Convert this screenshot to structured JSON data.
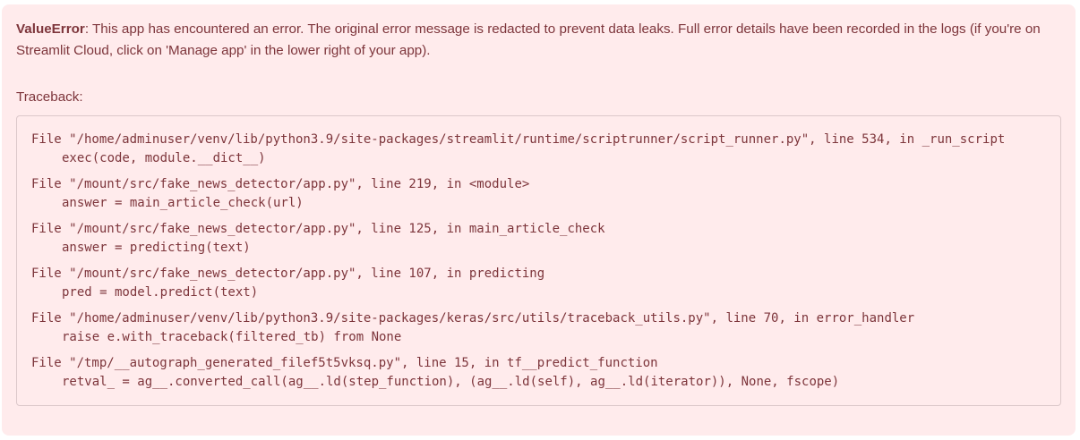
{
  "error": {
    "type": "ValueError",
    "message": ": This app has encountered an error. The original error message is redacted to prevent data leaks. Full error details have been recorded in the logs (if you're on Streamlit Cloud, click on 'Manage app' in the lower right of your app).",
    "traceback_label": "Traceback:",
    "frames": [
      {
        "location": "File \"/home/adminuser/venv/lib/python3.9/site-packages/streamlit/runtime/scriptrunner/script_runner.py\", line 534, in _run_script",
        "code": "exec(code, module.__dict__)"
      },
      {
        "location": "File \"/mount/src/fake_news_detector/app.py\", line 219, in <module>",
        "code": "answer = main_article_check(url)"
      },
      {
        "location": "File \"/mount/src/fake_news_detector/app.py\", line 125, in main_article_check",
        "code": "answer = predicting(text)"
      },
      {
        "location": "File \"/mount/src/fake_news_detector/app.py\", line 107, in predicting",
        "code": "pred = model.predict(text)"
      },
      {
        "location": "File \"/home/adminuser/venv/lib/python3.9/site-packages/keras/src/utils/traceback_utils.py\", line 70, in error_handler",
        "code": "raise e.with_traceback(filtered_tb) from None"
      },
      {
        "location": "File \"/tmp/__autograph_generated_filef5t5vksq.py\", line 15, in tf__predict_function",
        "code": "retval_ = ag__.converted_call(ag__.ld(step_function), (ag__.ld(self), ag__.ld(iterator)), None, fscope)"
      }
    ]
  },
  "colors": {
    "background": "#ffebec",
    "text": "#7d353b",
    "border": "#dcc8ca"
  }
}
